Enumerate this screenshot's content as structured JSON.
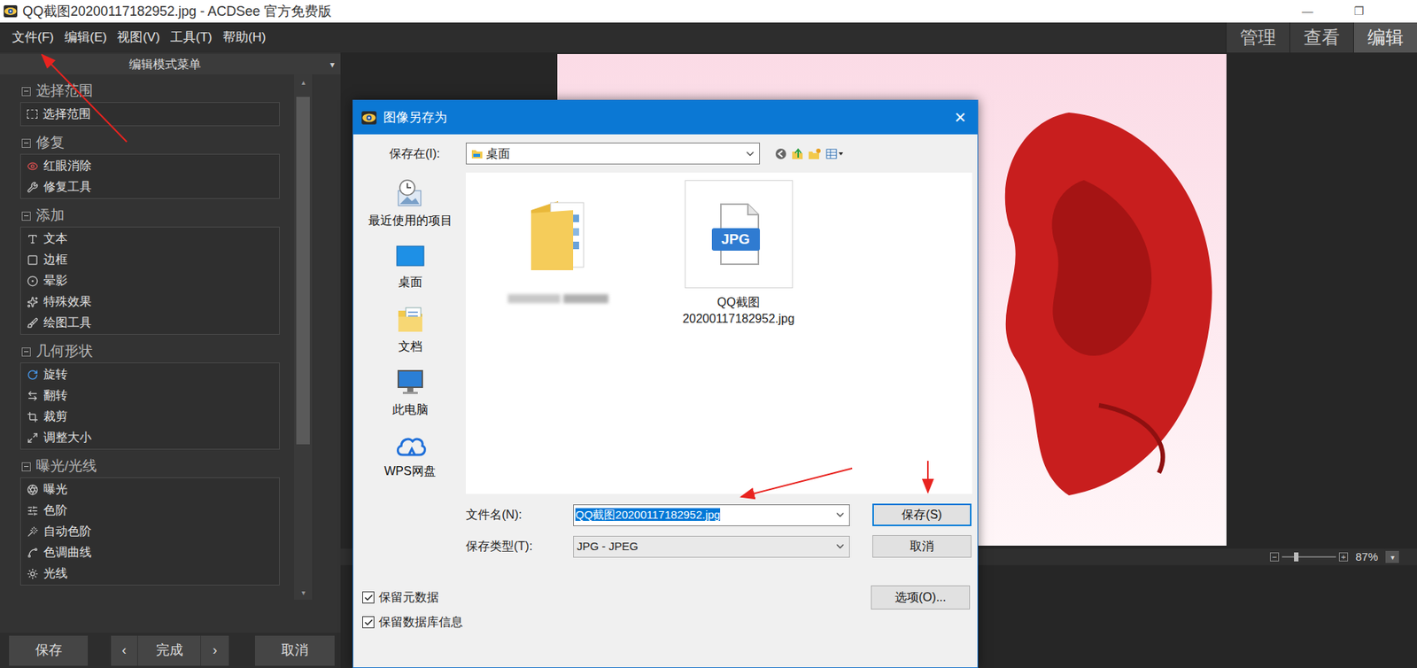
{
  "window": {
    "title": "QQ截图20200117182952.jpg - ACDSee 官方免费版",
    "controls": [
      "—",
      "❐"
    ]
  },
  "menu": [
    "文件(F)",
    "编辑(E)",
    "视图(V)",
    "工具(T)",
    "帮助(H)"
  ],
  "modes": [
    {
      "label": "管理",
      "selected": false
    },
    {
      "label": "查看",
      "selected": false
    },
    {
      "label": "编辑",
      "selected": true
    }
  ],
  "sidebar": {
    "title": "编辑模式菜单",
    "dropdown": "▾",
    "scroll_up": "▴",
    "scroll_down": "▾",
    "sections": [
      {
        "title": "选择范围",
        "expanded": true,
        "items": [
          "选择范围"
        ]
      },
      {
        "title": "修复",
        "expanded": true,
        "items": [
          "红眼消除",
          "修复工具"
        ]
      },
      {
        "title": "添加",
        "expanded": true,
        "items": [
          "文本",
          "边框",
          "晕影",
          "特殊效果",
          "绘图工具"
        ]
      },
      {
        "title": "几何形状",
        "expanded": true,
        "items": [
          "旋转",
          "翻转",
          "裁剪",
          "调整大小"
        ]
      },
      {
        "title": "曝光/光线",
        "expanded": true,
        "items": [
          "曝光",
          "色阶",
          "自动色阶",
          "色调曲线",
          "光线"
        ]
      }
    ]
  },
  "bottom_bar": {
    "buttons": [
      "保存",
      "‹",
      "完成",
      "›",
      "取消"
    ]
  },
  "zoom": {
    "minus": "−",
    "plus": "+",
    "level": 0.25,
    "reading": "87%",
    "dropdown": "▾"
  },
  "dialog": {
    "title": "图像另存为",
    "close": "×",
    "location": {
      "label": "保存在(I):",
      "value": "桌面"
    },
    "places": [
      {
        "label": "最近使用的项目",
        "kind": "recent"
      },
      {
        "label": "桌面",
        "kind": "desktop"
      },
      {
        "label": "文档",
        "kind": "documents"
      },
      {
        "label": "此电脑",
        "kind": "computer"
      },
      {
        "label": "WPS网盘",
        "kind": "cloud"
      }
    ],
    "files": [
      {
        "kind": "folder",
        "blurred": true,
        "lines": []
      },
      {
        "kind": "image",
        "blurred": false,
        "badge": "JPG",
        "lines": [
          "QQ截图",
          "20200117182952.jpg"
        ]
      }
    ],
    "filename": {
      "label": "文件名(N):",
      "value": "QQ截图20200117182952.jpg",
      "selected": true
    },
    "filetype": {
      "label": "保存类型(T):",
      "value": "JPG - JPEG"
    },
    "save": {
      "label": "保存(S)",
      "default": true
    },
    "cancel": "取消",
    "options": "选项(O)...",
    "checkboxes": [
      {
        "label": "保留元数据",
        "checked": true
      },
      {
        "label": "保留数据库信息",
        "checked": true
      }
    ]
  }
}
